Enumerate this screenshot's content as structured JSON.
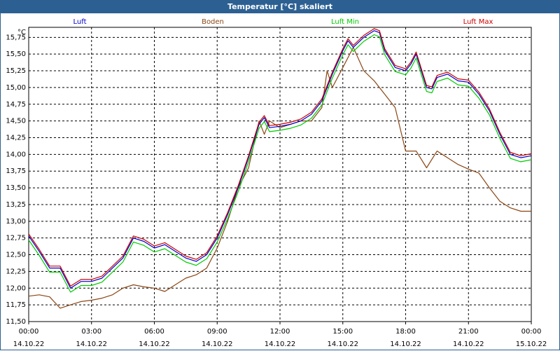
{
  "window": {
    "title": "Temperatur [°C] skaliert"
  },
  "chart_data": {
    "type": "line",
    "title": "Temperatur [°C] skaliert",
    "ylabel": "°C",
    "ylim": [
      11.5,
      15.9
    ],
    "xlim_hours": [
      0,
      24
    ],
    "grid": true,
    "legend_position": "top",
    "y_ticks": [
      "11,50",
      "11,75",
      "12,00",
      "12,25",
      "12,50",
      "12,75",
      "13,00",
      "13,25",
      "13,50",
      "13,75",
      "14,00",
      "14,25",
      "14,50",
      "14,75",
      "15,00",
      "15,25",
      "15,50",
      "15,75"
    ],
    "y_tick_values": [
      11.5,
      11.75,
      12.0,
      12.25,
      12.5,
      12.75,
      13.0,
      13.25,
      13.5,
      13.75,
      14.0,
      14.25,
      14.5,
      14.75,
      15.0,
      15.25,
      15.5,
      15.75
    ],
    "x_ticks": [
      {
        "hour": 0,
        "time": "00:00",
        "date": "14.10.22"
      },
      {
        "hour": 3,
        "time": "03:00",
        "date": "14.10.22"
      },
      {
        "hour": 6,
        "time": "06:00",
        "date": "14.10.22"
      },
      {
        "hour": 9,
        "time": "09:00",
        "date": "14.10.22"
      },
      {
        "hour": 12,
        "time": "12:00",
        "date": "14.10.22"
      },
      {
        "hour": 15,
        "time": "15:00",
        "date": "14.10.22"
      },
      {
        "hour": 18,
        "time": "18:00",
        "date": "14.10.22"
      },
      {
        "hour": 21,
        "time": "21:00",
        "date": "14.10.22"
      },
      {
        "hour": 24,
        "time": "00:00",
        "date": "15.10.22"
      }
    ],
    "series": [
      {
        "name": "Luft",
        "color": "#0000cc",
        "x": [
          0,
          0.5,
          1,
          1.5,
          2,
          2.5,
          3,
          3.5,
          4,
          4.5,
          5,
          5.5,
          6,
          6.5,
          7,
          7.5,
          8,
          8.5,
          9,
          9.5,
          10,
          10.5,
          11,
          11.25,
          11.5,
          12,
          12.5,
          13,
          13.5,
          14,
          14.5,
          15,
          15.25,
          15.5,
          16,
          16.5,
          16.75,
          17,
          17.5,
          18,
          18.25,
          18.5,
          19,
          19.25,
          19.5,
          20,
          20.5,
          21,
          21.5,
          22,
          22.5,
          23,
          23.5,
          24
        ],
        "y": [
          12.78,
          12.55,
          12.3,
          12.3,
          12.0,
          12.1,
          12.1,
          12.15,
          12.3,
          12.45,
          12.75,
          12.7,
          12.6,
          12.65,
          12.55,
          12.45,
          12.4,
          12.5,
          12.75,
          13.1,
          13.5,
          13.95,
          14.45,
          14.55,
          14.4,
          14.42,
          14.45,
          14.5,
          14.6,
          14.8,
          15.2,
          15.55,
          15.7,
          15.6,
          15.75,
          15.85,
          15.82,
          15.55,
          15.3,
          15.25,
          15.35,
          15.5,
          15.0,
          14.98,
          15.15,
          15.2,
          15.1,
          15.08,
          14.9,
          14.65,
          14.3,
          14.0,
          13.95,
          13.98
        ]
      },
      {
        "name": "Boden",
        "color": "#8b4513",
        "x": [
          0,
          0.5,
          1,
          1.5,
          2,
          2.5,
          3,
          3.5,
          4,
          4.5,
          5,
          5.5,
          6,
          6.5,
          7,
          7.5,
          8,
          8.5,
          9,
          9.5,
          10,
          10.5,
          11,
          11.25,
          11.5,
          12,
          12.5,
          13,
          13.5,
          14,
          14.25,
          14.5,
          15,
          15.5,
          16,
          16.5,
          17,
          17.5,
          18,
          18.5,
          19,
          19.5,
          20,
          20.5,
          21,
          21.5,
          22,
          22.5,
          23,
          23.5,
          24
        ],
        "y": [
          11.88,
          11.9,
          11.87,
          11.7,
          11.75,
          11.8,
          11.82,
          11.85,
          11.9,
          12.0,
          12.05,
          12.02,
          12.0,
          11.95,
          12.05,
          12.15,
          12.2,
          12.3,
          12.6,
          13.0,
          13.5,
          13.8,
          14.5,
          14.3,
          14.5,
          14.4,
          14.45,
          14.5,
          14.5,
          14.7,
          15.25,
          15.0,
          15.3,
          15.6,
          15.25,
          15.1,
          14.9,
          14.7,
          14.05,
          14.05,
          13.8,
          14.05,
          13.95,
          13.85,
          13.78,
          13.72,
          13.5,
          13.3,
          13.2,
          13.15,
          13.15
        ]
      },
      {
        "name": "Luft Min",
        "color": "#00cc00",
        "x": [
          0,
          0.5,
          1,
          1.5,
          2,
          2.5,
          3,
          3.5,
          4,
          4.5,
          5,
          5.5,
          6,
          6.5,
          7,
          7.5,
          8,
          8.5,
          9,
          9.5,
          10,
          10.5,
          11,
          11.25,
          11.5,
          12,
          12.5,
          13,
          13.5,
          14,
          14.5,
          15,
          15.25,
          15.5,
          16,
          16.5,
          16.75,
          17,
          17.5,
          18,
          18.25,
          18.5,
          19,
          19.25,
          19.5,
          20,
          20.5,
          21,
          21.5,
          22,
          22.5,
          23,
          23.5,
          24
        ],
        "y": [
          12.72,
          12.49,
          12.24,
          12.24,
          11.94,
          12.04,
          12.04,
          12.09,
          12.24,
          12.39,
          12.69,
          12.64,
          12.54,
          12.59,
          12.49,
          12.39,
          12.34,
          12.44,
          12.69,
          13.04,
          13.44,
          13.89,
          14.39,
          14.49,
          14.34,
          14.36,
          14.39,
          14.44,
          14.54,
          14.74,
          15.14,
          15.49,
          15.64,
          15.54,
          15.69,
          15.79,
          15.76,
          15.49,
          15.24,
          15.19,
          15.29,
          15.44,
          14.94,
          14.92,
          15.09,
          15.14,
          15.04,
          15.02,
          14.84,
          14.59,
          14.24,
          13.94,
          13.89,
          13.92
        ]
      },
      {
        "name": "Luft Max",
        "color": "#cc0000",
        "x": [
          0,
          0.5,
          1,
          1.5,
          2,
          2.5,
          3,
          3.5,
          4,
          4.5,
          5,
          5.5,
          6,
          6.5,
          7,
          7.5,
          8,
          8.5,
          9,
          9.5,
          10,
          10.5,
          11,
          11.25,
          11.5,
          12,
          12.5,
          13,
          13.5,
          14,
          14.5,
          15,
          15.25,
          15.5,
          16,
          16.5,
          16.75,
          17,
          17.5,
          18,
          18.25,
          18.5,
          19,
          19.25,
          19.5,
          20,
          20.5,
          21,
          21.5,
          22,
          22.5,
          23,
          23.5,
          24
        ],
        "y": [
          12.81,
          12.58,
          12.33,
          12.33,
          12.03,
          12.13,
          12.13,
          12.18,
          12.33,
          12.48,
          12.78,
          12.73,
          12.63,
          12.68,
          12.58,
          12.48,
          12.43,
          12.53,
          12.78,
          13.13,
          13.53,
          13.98,
          14.48,
          14.58,
          14.43,
          14.45,
          14.48,
          14.53,
          14.63,
          14.83,
          15.23,
          15.58,
          15.73,
          15.63,
          15.78,
          15.88,
          15.85,
          15.58,
          15.33,
          15.28,
          15.38,
          15.53,
          15.03,
          15.01,
          15.18,
          15.23,
          15.13,
          15.11,
          14.93,
          14.68,
          14.33,
          14.03,
          13.98,
          14.01
        ]
      }
    ]
  }
}
